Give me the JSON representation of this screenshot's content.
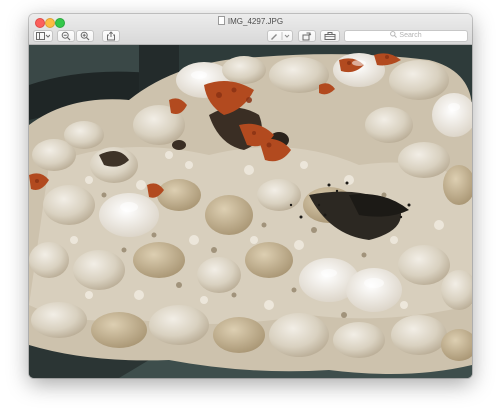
{
  "window": {
    "title": "IMG_4297.JPG"
  },
  "toolbar": {
    "sidebar_icon": "sidebar-icon",
    "zoom_out_icon": "zoom-out-icon",
    "zoom_in_icon": "zoom-in-icon",
    "share_icon": "share-icon",
    "markup_icon": "pen-icon",
    "rotate_icon": "rotate-icon",
    "toolbox_icon": "toolbox-icon"
  },
  "search": {
    "placeholder": "Search",
    "icon": "search-icon"
  },
  "colors": {
    "close": "#fc605c",
    "minimize": "#fdbc40",
    "maximize": "#34c84a"
  }
}
